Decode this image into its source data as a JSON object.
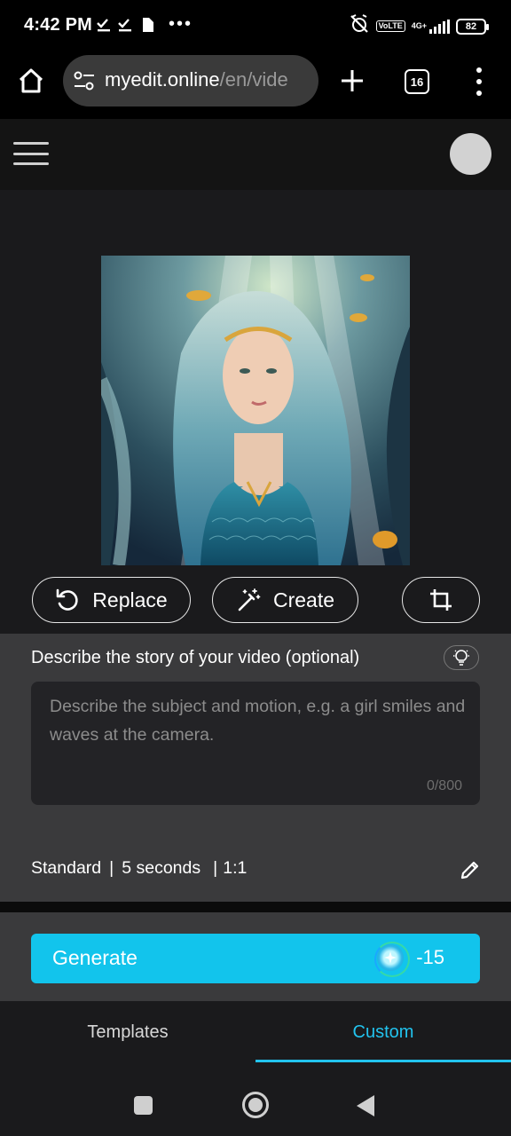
{
  "status_bar": {
    "time": "4:42 PM",
    "network_badge": "VoLTE",
    "network_type": "4G+",
    "battery": "82"
  },
  "browser": {
    "url_host": "myedit.online",
    "url_path": "/en/vide",
    "tab_count": "16"
  },
  "editor": {
    "replace_label": "Replace",
    "create_label": "Create"
  },
  "prompt": {
    "label": "Describe the story of your video (optional)",
    "placeholder": "Describe the subject and motion, e.g. a girl smiles and waves at the camera.",
    "char_count": "0/800"
  },
  "settings": {
    "quality": "Standard",
    "duration": "5 seconds",
    "ratio": "1:1"
  },
  "generate": {
    "label": "Generate",
    "cost": "-15"
  },
  "tabs": {
    "templates": "Templates",
    "custom": "Custom",
    "active": "Custom"
  },
  "colors": {
    "accent": "#12c4ec",
    "active_tab": "#22c3ee",
    "panel_bg": "#3a3a3c",
    "main_bg": "#1a1a1c"
  }
}
